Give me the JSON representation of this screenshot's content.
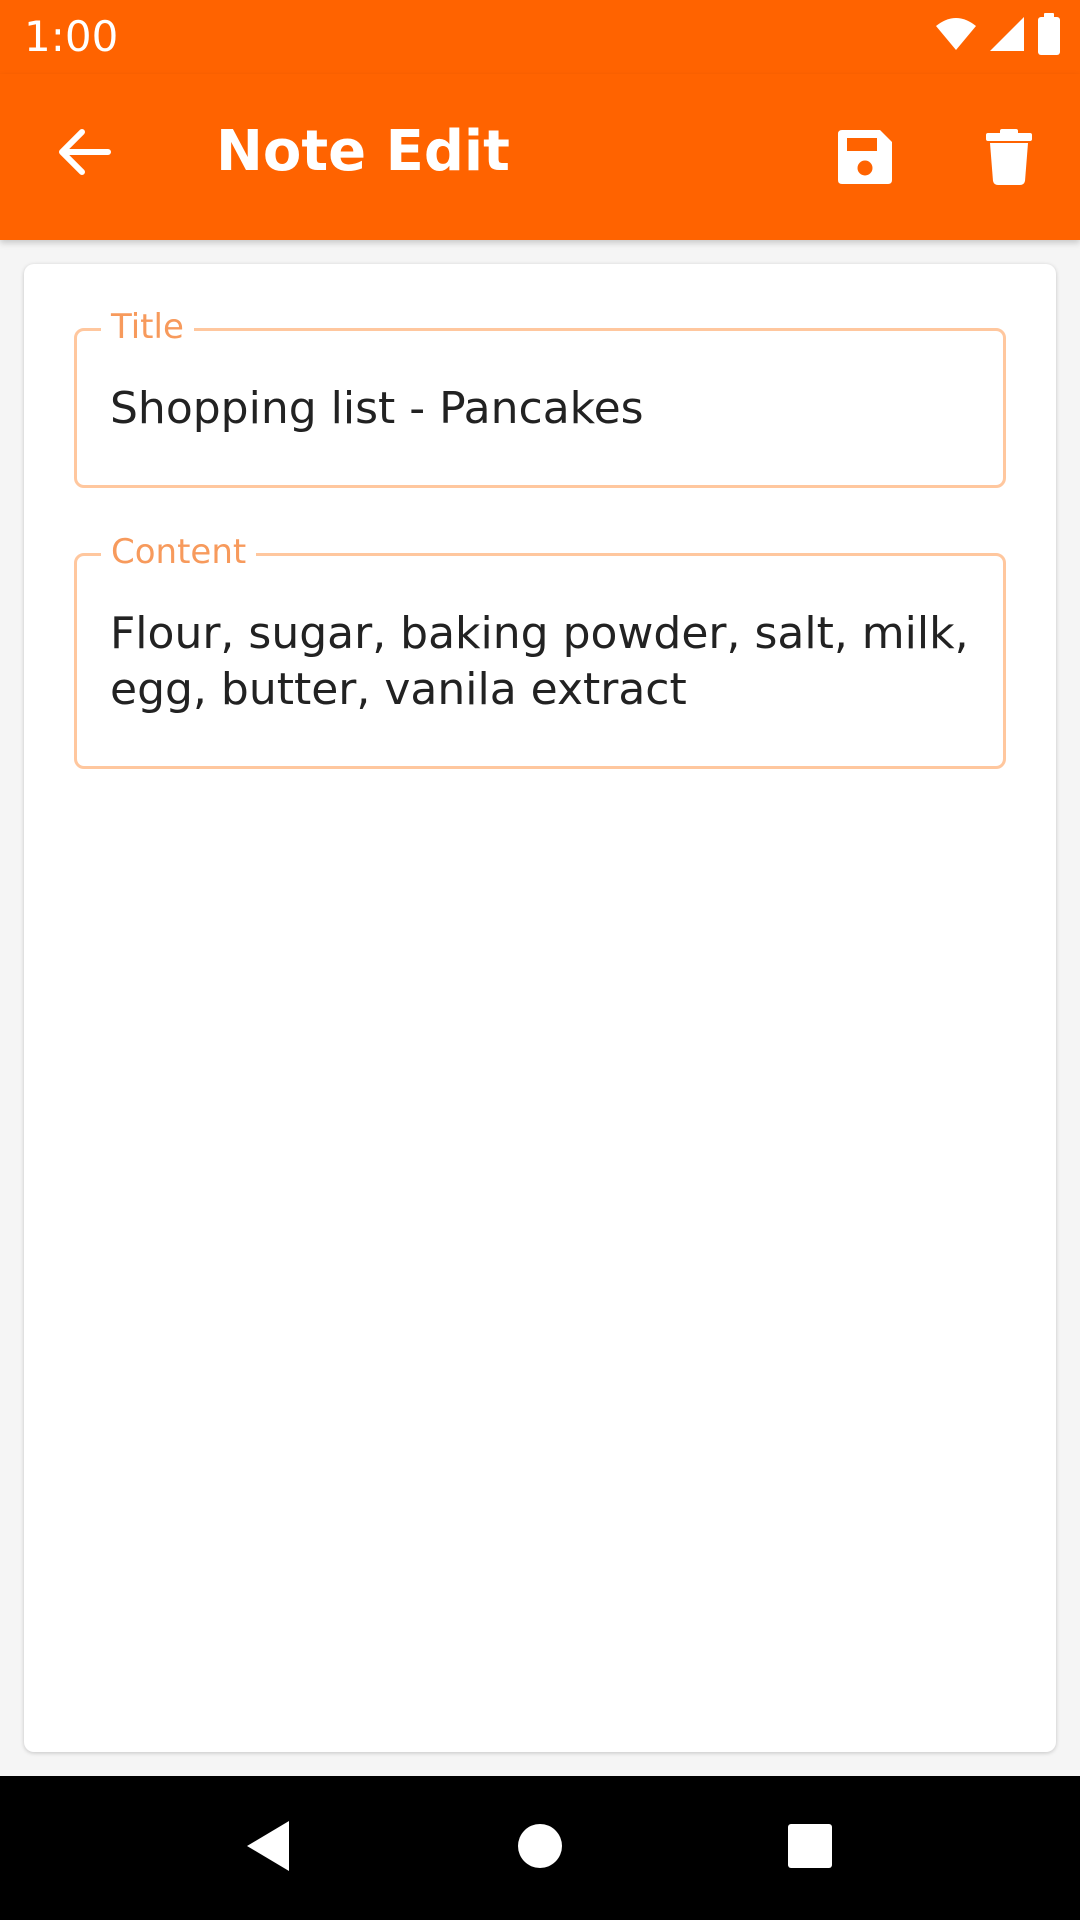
{
  "status_bar": {
    "time": "1:00",
    "icons": [
      "wifi-icon",
      "signal-icon",
      "battery-icon"
    ]
  },
  "app_bar": {
    "title": "Note Edit",
    "actions": [
      "back-arrow-icon",
      "save-icon",
      "delete-icon"
    ]
  },
  "form": {
    "title_label": "Title",
    "title_value": "Shopping list - Pancakes",
    "content_label": "Content",
    "content_value": "Flour, sugar, baking powder, salt, milk, egg, butter, vanila extract"
  },
  "nav_bar": {
    "buttons": [
      "nav-back-icon",
      "nav-home-icon",
      "nav-recents-icon"
    ]
  },
  "colors": {
    "primary": "#ff6300",
    "field_border": "#ffc79e",
    "field_label": "#f79a5c",
    "text": "#222222"
  }
}
